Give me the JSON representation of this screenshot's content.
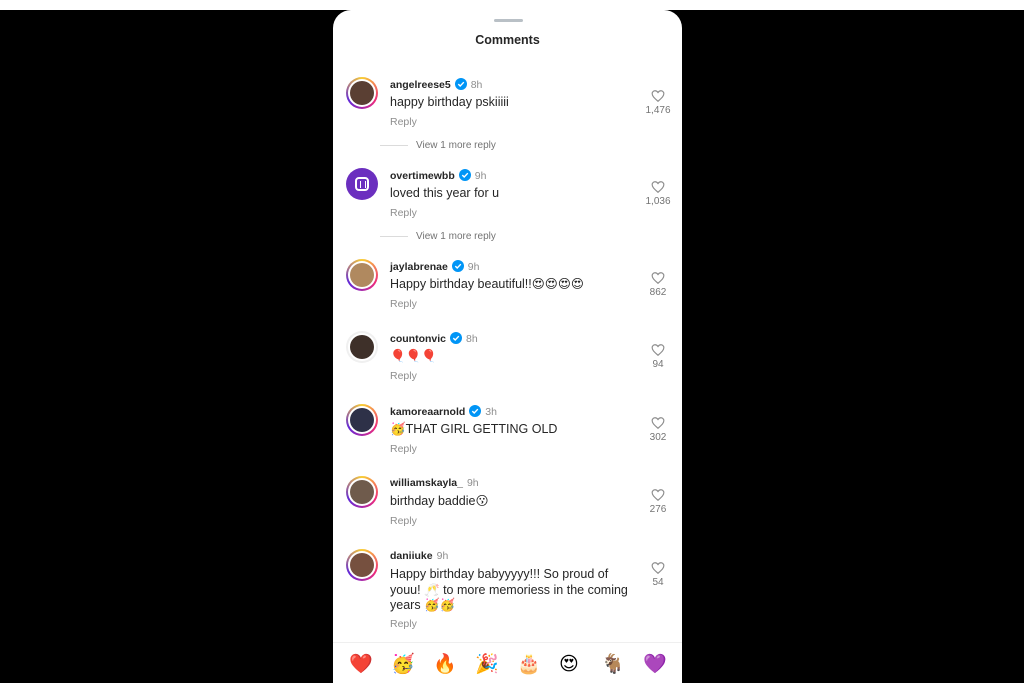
{
  "sheet": {
    "title": "Comments"
  },
  "comments": [
    {
      "user": "angelreese5",
      "verified": true,
      "time": "8h",
      "text": "happy birthday pskiiiii",
      "likes": "1,476",
      "reply": "Reply",
      "more": "View 1 more reply",
      "avatar": "#5a3f33"
    },
    {
      "user": "overtimewbb",
      "verified": true,
      "time": "9h",
      "text": "loved this year for u",
      "likes": "1,036",
      "reply": "Reply",
      "more": "View 1 more reply",
      "avatar": "#6b2fbf"
    },
    {
      "user": "jaylabrenae",
      "verified": true,
      "time": "9h",
      "text": "Happy birthday beautiful!!😍😍😍😍",
      "likes": "862",
      "reply": "Reply",
      "avatar": "#b0895f"
    },
    {
      "user": "countonvic",
      "verified": true,
      "time": "8h",
      "text": "🎈🎈🎈",
      "likes": "94",
      "reply": "Reply",
      "avatar": "#3e3029"
    },
    {
      "user": "kamoreaarnold",
      "verified": true,
      "time": "3h",
      "text": "🥳THAT GIRL GETTING OLD",
      "likes": "302",
      "reply": "Reply",
      "avatar": "#2e3148"
    },
    {
      "user": "williamskayla_",
      "verified": false,
      "time": "9h",
      "text": "birthday baddie😗",
      "likes": "276",
      "reply": "Reply",
      "avatar": "#6f5b4c"
    },
    {
      "user": "daniiuke",
      "verified": false,
      "time": "9h",
      "text": "Happy birthday babyyyyy!!! So proud of youu! 🥂 to more memoriess in the coming years 🥳🥳",
      "likes": "54",
      "reply": "Reply",
      "avatar": "#76503f"
    }
  ],
  "emoji_bar": [
    "❤️",
    "🥳",
    "🔥",
    "🎉",
    "🎂",
    "😍",
    "🐐",
    "💜"
  ],
  "colors": {
    "verified": "#0095f6",
    "text": "#262626",
    "muted": "#8e8e8e"
  }
}
